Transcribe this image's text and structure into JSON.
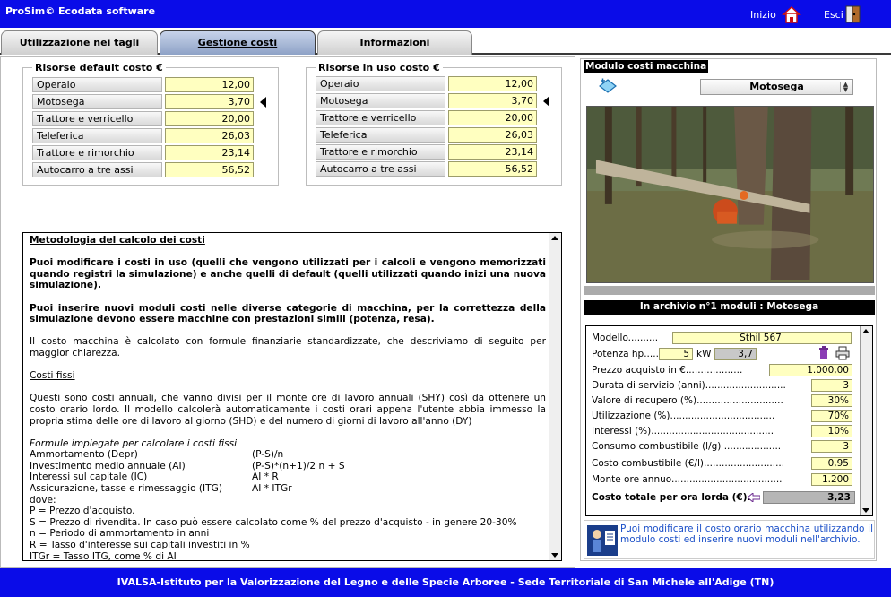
{
  "app": {
    "title": "ProSim© Ecodata software"
  },
  "nav": {
    "home_label": "Inizio",
    "exit_label": "Esci"
  },
  "tabs": [
    {
      "label": "Utilizzazione nei tagli ordinari"
    },
    {
      "label": "Gestione costi"
    },
    {
      "label": "Informazioni"
    }
  ],
  "default_costs": {
    "title": "Risorse default costo  €",
    "rows": [
      {
        "label": "Operaio",
        "value": "12,00"
      },
      {
        "label": "Motosega",
        "value": "3,70"
      },
      {
        "label": "Trattore e verricello",
        "value": "20,00"
      },
      {
        "label": "Teleferica",
        "value": "26,03"
      },
      {
        "label": "Trattore e rimorchio",
        "value": "23,14"
      },
      {
        "label": "Autocarro a tre assi",
        "value": "56,52"
      }
    ]
  },
  "used_costs": {
    "title": "Risorse in uso costo  €",
    "rows": [
      {
        "label": "Operaio",
        "value": "12,00"
      },
      {
        "label": "Motosega",
        "value": "3,70"
      },
      {
        "label": "Trattore e verricello",
        "value": "20,00"
      },
      {
        "label": "Teleferica",
        "value": "26,03"
      },
      {
        "label": "Trattore e rimorchio",
        "value": "23,14"
      },
      {
        "label": "Autocarro a tre assi",
        "value": "56,52"
      }
    ]
  },
  "method": {
    "heading": "Metodologia del calcolo dei costi",
    "p1": "Puoi modificare i costi in uso (quelli che vengono utilizzati per i calcoli e vengono memorizzati quando registri la simulazione) e anche quelli di default (quelli utilizzati quando inizi una nuova simulazione).",
    "p2": "Puoi inserire nuovi moduli costi nelle diverse categorie di macchina, per la correttezza della simulazione devono essere macchine con prestazioni simili (potenza, resa).",
    "p3": "Il costo macchina è calcolato con formule finanziarie standardizzate, che descriviamo di seguito per maggior chiarezza.",
    "fixed_heading": "Costi fissi",
    "p4": "Questi sono costi annuali, che vanno divisi per il monte ore di lavoro annuali (SHY) così da ottenere un costo orario lordo. Il modello calcolerà automaticamente i costi orari appena l'utente abbia immesso la propria stima delle ore di lavoro al giorno (SHD) e del numero di giorni di lavoro all'anno (DY)",
    "formulas_heading": "Formule impiegate per calcolare i costi fissi",
    "formulas": [
      {
        "name": "Ammortamento (Depr)",
        "expr": "(P-S)/n"
      },
      {
        "name": "Investimento medio annuale (AI)",
        "expr": "(P-S)*(n+1)/2 n + S"
      },
      {
        "name": "Interessi sul capitale (IC)",
        "expr": " AI * R"
      },
      {
        "name": "Assicurazione, tasse e rimessaggio (ITG)",
        "expr": " AI * ITGr"
      }
    ],
    "dove": "dove:",
    "def_p": "P = Prezzo d'acquisto.",
    "def_s": "S = Prezzo di rivendita. In caso può essere calcolato come % del prezzo d'acquisto - in genere 20-30%",
    "def_n": "n = Periodo di ammortamento in anni",
    "def_r": "R = Tasso d'interesse sui capitali investiti in %",
    "def_itgr": "ITGr = Tasso ITG, come % di AI"
  },
  "module": {
    "title": "Modulo costi macchina",
    "selected_machine": "Motosega",
    "archive_label": "In archivio n°1 moduli : Motosega",
    "fields": {
      "modello_label": "Modello..........",
      "modello_value": "Sthil 567",
      "potenza_label": "Potenza hp.....",
      "potenza_hp": "5",
      "kw_label": "kW",
      "potenza_kw": "3,7",
      "prezzo_label": "Prezzo acquisto in €...................",
      "prezzo_value": "1.000,00",
      "durata_label": "Durata di servizio (anni)...........................",
      "durata_value": "3",
      "recupero_label": "Valore di recupero (%).............................",
      "recupero_value": "30%",
      "utilizzazione_label": "Utilizzazione (%)...................................",
      "utilizzazione_value": "70%",
      "interessi_label": "Interessi (%).........................................",
      "interessi_value": "10%",
      "consumo_label": "Consumo combustibile (l/g) ...................",
      "consumo_value": "3",
      "costo_comb_label": "Costo combustibile (€/l)...........................",
      "costo_comb_value": "0,95",
      "monte_ore_label": "Monte ore annuo.....................................",
      "monte_ore_value": "1.200",
      "totale_label": "Costo totale per ora lorda (€)..",
      "totale_value": "3,23"
    },
    "info_text": "Puoi modificare il costo orario macchina utilizzando il modulo costi ed inserire nuovi moduli nell'archivio."
  },
  "footer": {
    "text": "IVALSA-Istituto per la Valorizzazione del Legno e delle Specie Arboree - Sede Territoriale di San Michele all'Adige (TN)"
  },
  "colors": {
    "brand_blue": "#0a0ce8",
    "input_yellow": "#ffffc0",
    "info_text": "#1a4fc8"
  }
}
